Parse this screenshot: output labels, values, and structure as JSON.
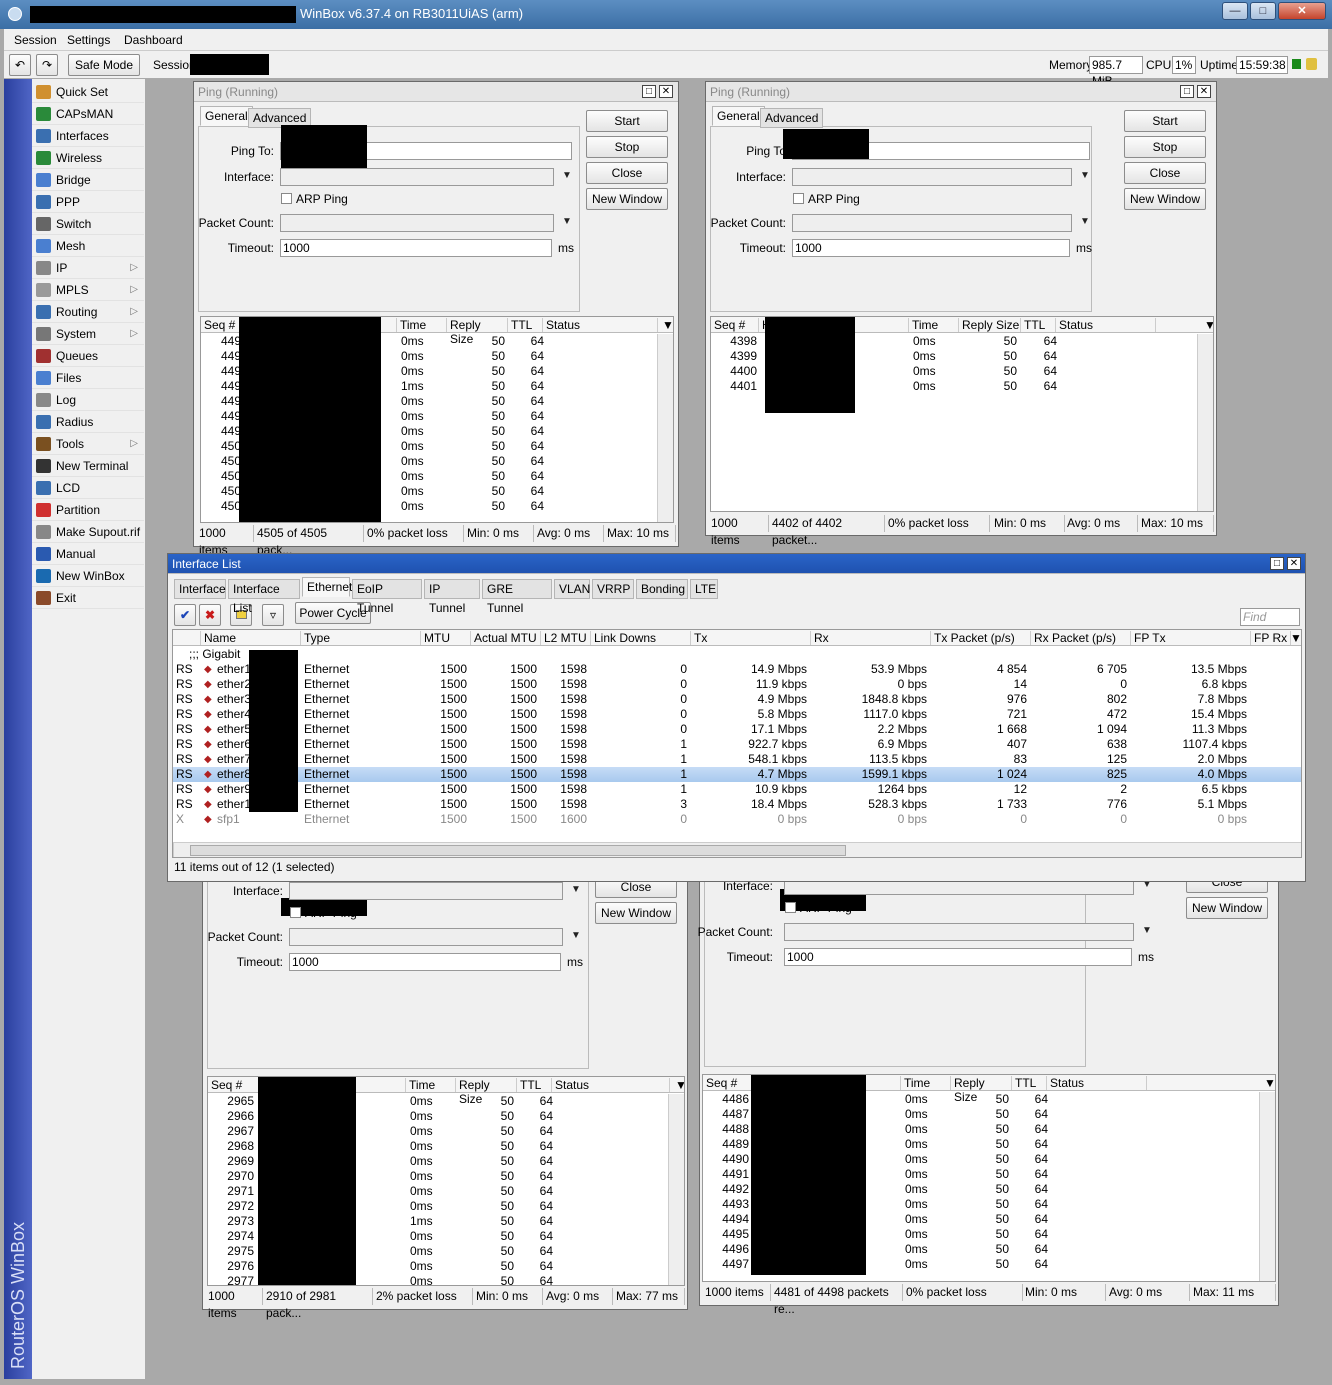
{
  "app": {
    "title": "WinBox v6.37.4 on RB3011UiAS (arm)",
    "brand": "RouterOS WinBox"
  },
  "menu": [
    "Session",
    "Settings",
    "Dashboard"
  ],
  "toolbar": {
    "safe_mode": "Safe Mode",
    "session_label": "Session",
    "memory_label": "Memory:",
    "memory": "985.7 MiB",
    "cpu_label": "CPU:",
    "cpu": "1%",
    "uptime_label": "Uptime:",
    "uptime": "15:59:38"
  },
  "sidebar": [
    {
      "label": "Quick Set",
      "icon": "wand-icon",
      "sub": false
    },
    {
      "label": "CAPsMAN",
      "icon": "antenna-icon",
      "sub": false
    },
    {
      "label": "Interfaces",
      "icon": "interface-icon",
      "sub": false
    },
    {
      "label": "Wireless",
      "icon": "wireless-icon",
      "sub": false
    },
    {
      "label": "Bridge",
      "icon": "bridge-icon",
      "sub": false
    },
    {
      "label": "PPP",
      "icon": "ppp-icon",
      "sub": false
    },
    {
      "label": "Switch",
      "icon": "switch-icon",
      "sub": false
    },
    {
      "label": "Mesh",
      "icon": "mesh-icon",
      "sub": false
    },
    {
      "label": "IP",
      "icon": "ip-icon",
      "sub": true
    },
    {
      "label": "MPLS",
      "icon": "mpls-icon",
      "sub": true
    },
    {
      "label": "Routing",
      "icon": "routing-icon",
      "sub": true
    },
    {
      "label": "System",
      "icon": "gear-icon",
      "sub": true
    },
    {
      "label": "Queues",
      "icon": "queue-icon",
      "sub": false
    },
    {
      "label": "Files",
      "icon": "folder-icon",
      "sub": false
    },
    {
      "label": "Log",
      "icon": "log-icon",
      "sub": false
    },
    {
      "label": "Radius",
      "icon": "radius-icon",
      "sub": false
    },
    {
      "label": "Tools",
      "icon": "tools-icon",
      "sub": true
    },
    {
      "label": "New Terminal",
      "icon": "terminal-icon",
      "sub": false
    },
    {
      "label": "LCD",
      "icon": "lcd-icon",
      "sub": false
    },
    {
      "label": "Partition",
      "icon": "partition-icon",
      "sub": false
    },
    {
      "label": "Make Supout.rif",
      "icon": "supout-icon",
      "sub": false
    },
    {
      "label": "Manual",
      "icon": "help-icon",
      "sub": false
    },
    {
      "label": "New WinBox",
      "icon": "winbox-icon",
      "sub": false
    },
    {
      "label": "Exit",
      "icon": "exit-icon",
      "sub": false
    }
  ],
  "ping_common": {
    "tab_general": "General",
    "tab_advanced": "Advanced",
    "ping_to": "Ping To:",
    "ping_to_short": "Ping To",
    "interface": "Interface:",
    "arp_ping": "ARP Ping",
    "packet_count": "Packet Count:",
    "timeout": "Timeout:",
    "timeout_value": "1000",
    "ms": "ms",
    "start": "Start",
    "stop": "Stop",
    "close": "Close",
    "new_window": "New Window",
    "col_seq": "Seq #",
    "col_host": "H",
    "col_time": "Time",
    "col_reply": "Reply Size",
    "col_ttl": "TTL",
    "col_status": "Status"
  },
  "ping1": {
    "title": "Ping (Running)",
    "status": [
      "1000 items",
      "4505 of 4505 pack...",
      "0% packet loss",
      "Min: 0 ms",
      "Avg: 0 ms",
      "Max: 10 ms"
    ],
    "rows": [
      [
        "449",
        "0ms",
        "50",
        "64"
      ],
      [
        "449",
        "0ms",
        "50",
        "64"
      ],
      [
        "449",
        "0ms",
        "50",
        "64"
      ],
      [
        "449",
        "1ms",
        "50",
        "64"
      ],
      [
        "449",
        "0ms",
        "50",
        "64"
      ],
      [
        "449",
        "0ms",
        "50",
        "64"
      ],
      [
        "449",
        "0ms",
        "50",
        "64"
      ],
      [
        "450",
        "0ms",
        "50",
        "64"
      ],
      [
        "450",
        "0ms",
        "50",
        "64"
      ],
      [
        "450",
        "0ms",
        "50",
        "64"
      ],
      [
        "450",
        "0ms",
        "50",
        "64"
      ],
      [
        "450",
        "0ms",
        "50",
        "64"
      ]
    ]
  },
  "ping2": {
    "title": "Ping (Running)",
    "status": [
      "1000 items",
      "4402 of 4402 packet...",
      "0% packet loss",
      "Min: 0 ms",
      "Avg: 0 ms",
      "Max: 10 ms"
    ],
    "rows": [
      [
        "4398",
        "0ms",
        "50",
        "64"
      ],
      [
        "4399",
        "0ms",
        "50",
        "64"
      ],
      [
        "4400",
        "0ms",
        "50",
        "64"
      ],
      [
        "4401",
        "0ms",
        "50",
        "64"
      ]
    ]
  },
  "ping3": {
    "status": [
      "1000 items",
      "2910 of 2981 pack...",
      "2% packet loss",
      "Min: 0 ms",
      "Avg: 0 ms",
      "Max: 77 ms"
    ],
    "rows": [
      [
        "2965",
        "0ms",
        "50",
        "64"
      ],
      [
        "2966",
        "0ms",
        "50",
        "64"
      ],
      [
        "2967",
        "0ms",
        "50",
        "64"
      ],
      [
        "2968",
        "0ms",
        "50",
        "64"
      ],
      [
        "2969",
        "0ms",
        "50",
        "64"
      ],
      [
        "2970",
        "0ms",
        "50",
        "64"
      ],
      [
        "2971",
        "0ms",
        "50",
        "64"
      ],
      [
        "2972",
        "0ms",
        "50",
        "64"
      ],
      [
        "2973",
        "1ms",
        "50",
        "64"
      ],
      [
        "2974",
        "0ms",
        "50",
        "64"
      ],
      [
        "2975",
        "0ms",
        "50",
        "64"
      ],
      [
        "2976",
        "0ms",
        "50",
        "64"
      ],
      [
        "2977",
        "0ms",
        "50",
        "64"
      ]
    ]
  },
  "ping4": {
    "status": [
      "1000 items",
      "4481 of 4498 packets re...",
      "0% packet loss",
      "Min: 0 ms",
      "Avg: 0 ms",
      "Max: 11 ms"
    ],
    "rows": [
      [
        "4486",
        "0ms",
        "50",
        "64"
      ],
      [
        "4487",
        "0ms",
        "50",
        "64"
      ],
      [
        "4488",
        "0ms",
        "50",
        "64"
      ],
      [
        "4489",
        "0ms",
        "50",
        "64"
      ],
      [
        "4490",
        "0ms",
        "50",
        "64"
      ],
      [
        "4491",
        "0ms",
        "50",
        "64"
      ],
      [
        "4492",
        "0ms",
        "50",
        "64"
      ],
      [
        "4493",
        "0ms",
        "50",
        "64"
      ],
      [
        "4494",
        "0ms",
        "50",
        "64"
      ],
      [
        "4495",
        "0ms",
        "50",
        "64"
      ],
      [
        "4496",
        "0ms",
        "50",
        "64"
      ],
      [
        "4497",
        "0ms",
        "50",
        "64"
      ]
    ]
  },
  "iflist": {
    "title": "Interface List",
    "tabs": [
      "Interface",
      "Interface List",
      "Ethernet",
      "EoIP Tunnel",
      "IP Tunnel",
      "GRE Tunnel",
      "VLAN",
      "VRRP",
      "Bonding",
      "LTE"
    ],
    "power_cycle": "Power Cycle",
    "find": "Find",
    "cols": [
      "Name",
      "Type",
      "MTU",
      "Actual MTU",
      "L2 MTU",
      "Link Downs",
      "Tx",
      "Rx",
      "Tx Packet (p/s)",
      "Rx Packet (p/s)",
      "FP Tx",
      "FP Rx"
    ],
    "group": ";;; Gigabit",
    "rows": [
      [
        "RS",
        "ether1",
        "Ethernet",
        "1500",
        "1500",
        "1598",
        "0",
        "14.9 Mbps",
        "53.9 Mbps",
        "4 854",
        "6 705",
        "13.5 Mbps"
      ],
      [
        "RS",
        "ether2",
        "Ethernet",
        "1500",
        "1500",
        "1598",
        "0",
        "11.9 kbps",
        "0 bps",
        "14",
        "0",
        "6.8 kbps"
      ],
      [
        "RS",
        "ether3",
        "Ethernet",
        "1500",
        "1500",
        "1598",
        "0",
        "4.9 Mbps",
        "1848.8 kbps",
        "976",
        "802",
        "7.8 Mbps"
      ],
      [
        "RS",
        "ether4",
        "Ethernet",
        "1500",
        "1500",
        "1598",
        "0",
        "5.8 Mbps",
        "1117.0 kbps",
        "721",
        "472",
        "15.4 Mbps"
      ],
      [
        "RS",
        "ether5",
        "Ethernet",
        "1500",
        "1500",
        "1598",
        "0",
        "17.1 Mbps",
        "2.2 Mbps",
        "1 668",
        "1 094",
        "11.3 Mbps"
      ],
      [
        "RS",
        "ether6",
        "Ethernet",
        "1500",
        "1500",
        "1598",
        "1",
        "922.7 kbps",
        "6.9 Mbps",
        "407",
        "638",
        "1107.4 kbps"
      ],
      [
        "RS",
        "ether7",
        "Ethernet",
        "1500",
        "1500",
        "1598",
        "1",
        "548.1 kbps",
        "113.5 kbps",
        "83",
        "125",
        "2.0 Mbps"
      ],
      [
        "RS",
        "ether8",
        "Ethernet",
        "1500",
        "1500",
        "1598",
        "1",
        "4.7 Mbps",
        "1599.1 kbps",
        "1 024",
        "825",
        "4.0 Mbps"
      ],
      [
        "RS",
        "ether9",
        "Ethernet",
        "1500",
        "1500",
        "1598",
        "1",
        "10.9 kbps",
        "1264 bps",
        "12",
        "2",
        "6.5 kbps"
      ],
      [
        "RS",
        "ether10",
        "Ethernet",
        "1500",
        "1500",
        "1598",
        "3",
        "18.4 Mbps",
        "528.3 kbps",
        "1 733",
        "776",
        "5.1 Mbps"
      ],
      [
        "X",
        "sfp1",
        "Ethernet",
        "1500",
        "1500",
        "1600",
        "0",
        "0 bps",
        "0 bps",
        "0",
        "0",
        "0 bps"
      ]
    ],
    "selected_row": 7,
    "status": "11 items out of 12 (1 selected)"
  }
}
